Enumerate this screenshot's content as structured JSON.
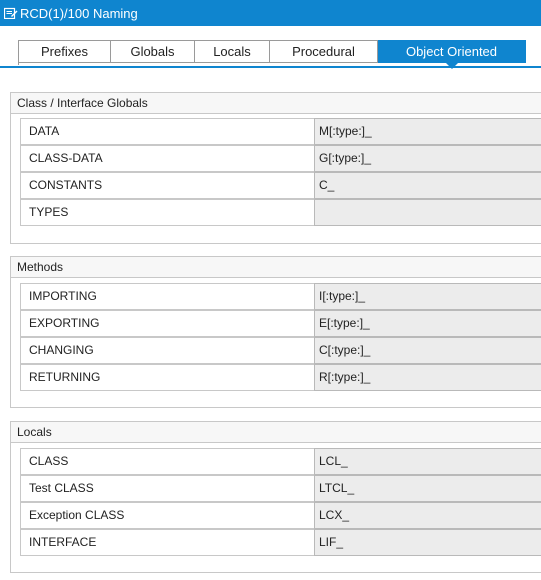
{
  "window": {
    "title": "RCD(1)/100 Naming"
  },
  "tabs": [
    {
      "label": "Prefixes",
      "active": false
    },
    {
      "label": "Globals",
      "active": false
    },
    {
      "label": "Locals",
      "active": false
    },
    {
      "label": "Procedural",
      "active": false
    },
    {
      "label": "Object Oriented",
      "active": true
    }
  ],
  "groups": {
    "class_globals": {
      "title": "Class / Interface Globals",
      "rows": [
        {
          "label": "DATA",
          "value": "M[:type:]_"
        },
        {
          "label": "CLASS-DATA",
          "value": "G[:type:]_"
        },
        {
          "label": "CONSTANTS",
          "value": "C_"
        },
        {
          "label": "TYPES",
          "value": ""
        }
      ]
    },
    "methods": {
      "title": "Methods",
      "rows": [
        {
          "label": "IMPORTING",
          "value": "I[:type:]_"
        },
        {
          "label": "EXPORTING",
          "value": "E[:type:]_"
        },
        {
          "label": "CHANGING",
          "value": "C[:type:]_"
        },
        {
          "label": "RETURNING",
          "value": "R[:type:]_"
        }
      ]
    },
    "locals": {
      "title": "Locals",
      "rows": [
        {
          "label": "CLASS",
          "value": "LCL_"
        },
        {
          "label": "Test CLASS",
          "value": "LTCL_"
        },
        {
          "label": "Exception CLASS",
          "value": "LCX_"
        },
        {
          "label": "INTERFACE",
          "value": "LIF_"
        }
      ]
    }
  },
  "colors": {
    "accent": "#0f85cf",
    "field_bg": "#ececec"
  },
  "icons": {
    "title": "edit-document-icon"
  }
}
